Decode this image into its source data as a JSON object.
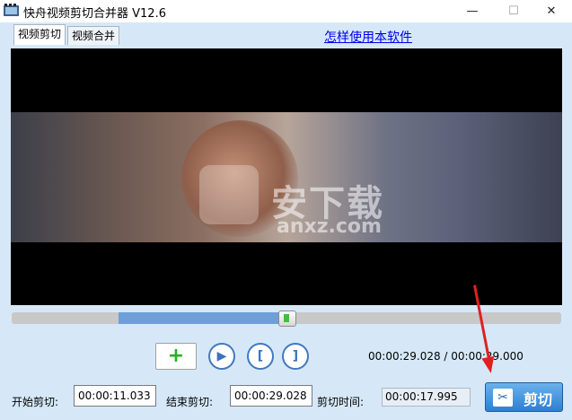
{
  "window": {
    "title": "快舟视频剪切合并器 V12.6",
    "minimize_glyph": "—",
    "maximize_glyph": "☐",
    "close_glyph": "✕"
  },
  "tabs": [
    {
      "label": "视频剪切",
      "active": true
    },
    {
      "label": "视频合并",
      "active": false
    }
  ],
  "help_link": "怎样使用本软件",
  "watermark": {
    "text": "安下载",
    "sub": "anxz.com"
  },
  "timeline": {
    "selection_start_fraction": 0.195,
    "selection_end_fraction": 0.5,
    "thumb_fraction": 0.5
  },
  "controls": {
    "add_glyph": "+",
    "play_glyph": "▶",
    "mark_in_glyph": "[",
    "mark_out_glyph": "]"
  },
  "time_display": "00:00:29.028 / 00:00:29.000",
  "start": {
    "label": "开始剪切:",
    "value": "00:00:11.033"
  },
  "end": {
    "label": "结束剪切:",
    "value": "00:00:29.028"
  },
  "duration": {
    "label": "剪切时间:",
    "value": "00:00:17.995"
  },
  "cut_button": {
    "label": "剪切",
    "icon_glyph": "✂"
  },
  "colors": {
    "accent": "#2e7fd0",
    "background": "#d6e8f8",
    "arrow": "#e02020"
  }
}
